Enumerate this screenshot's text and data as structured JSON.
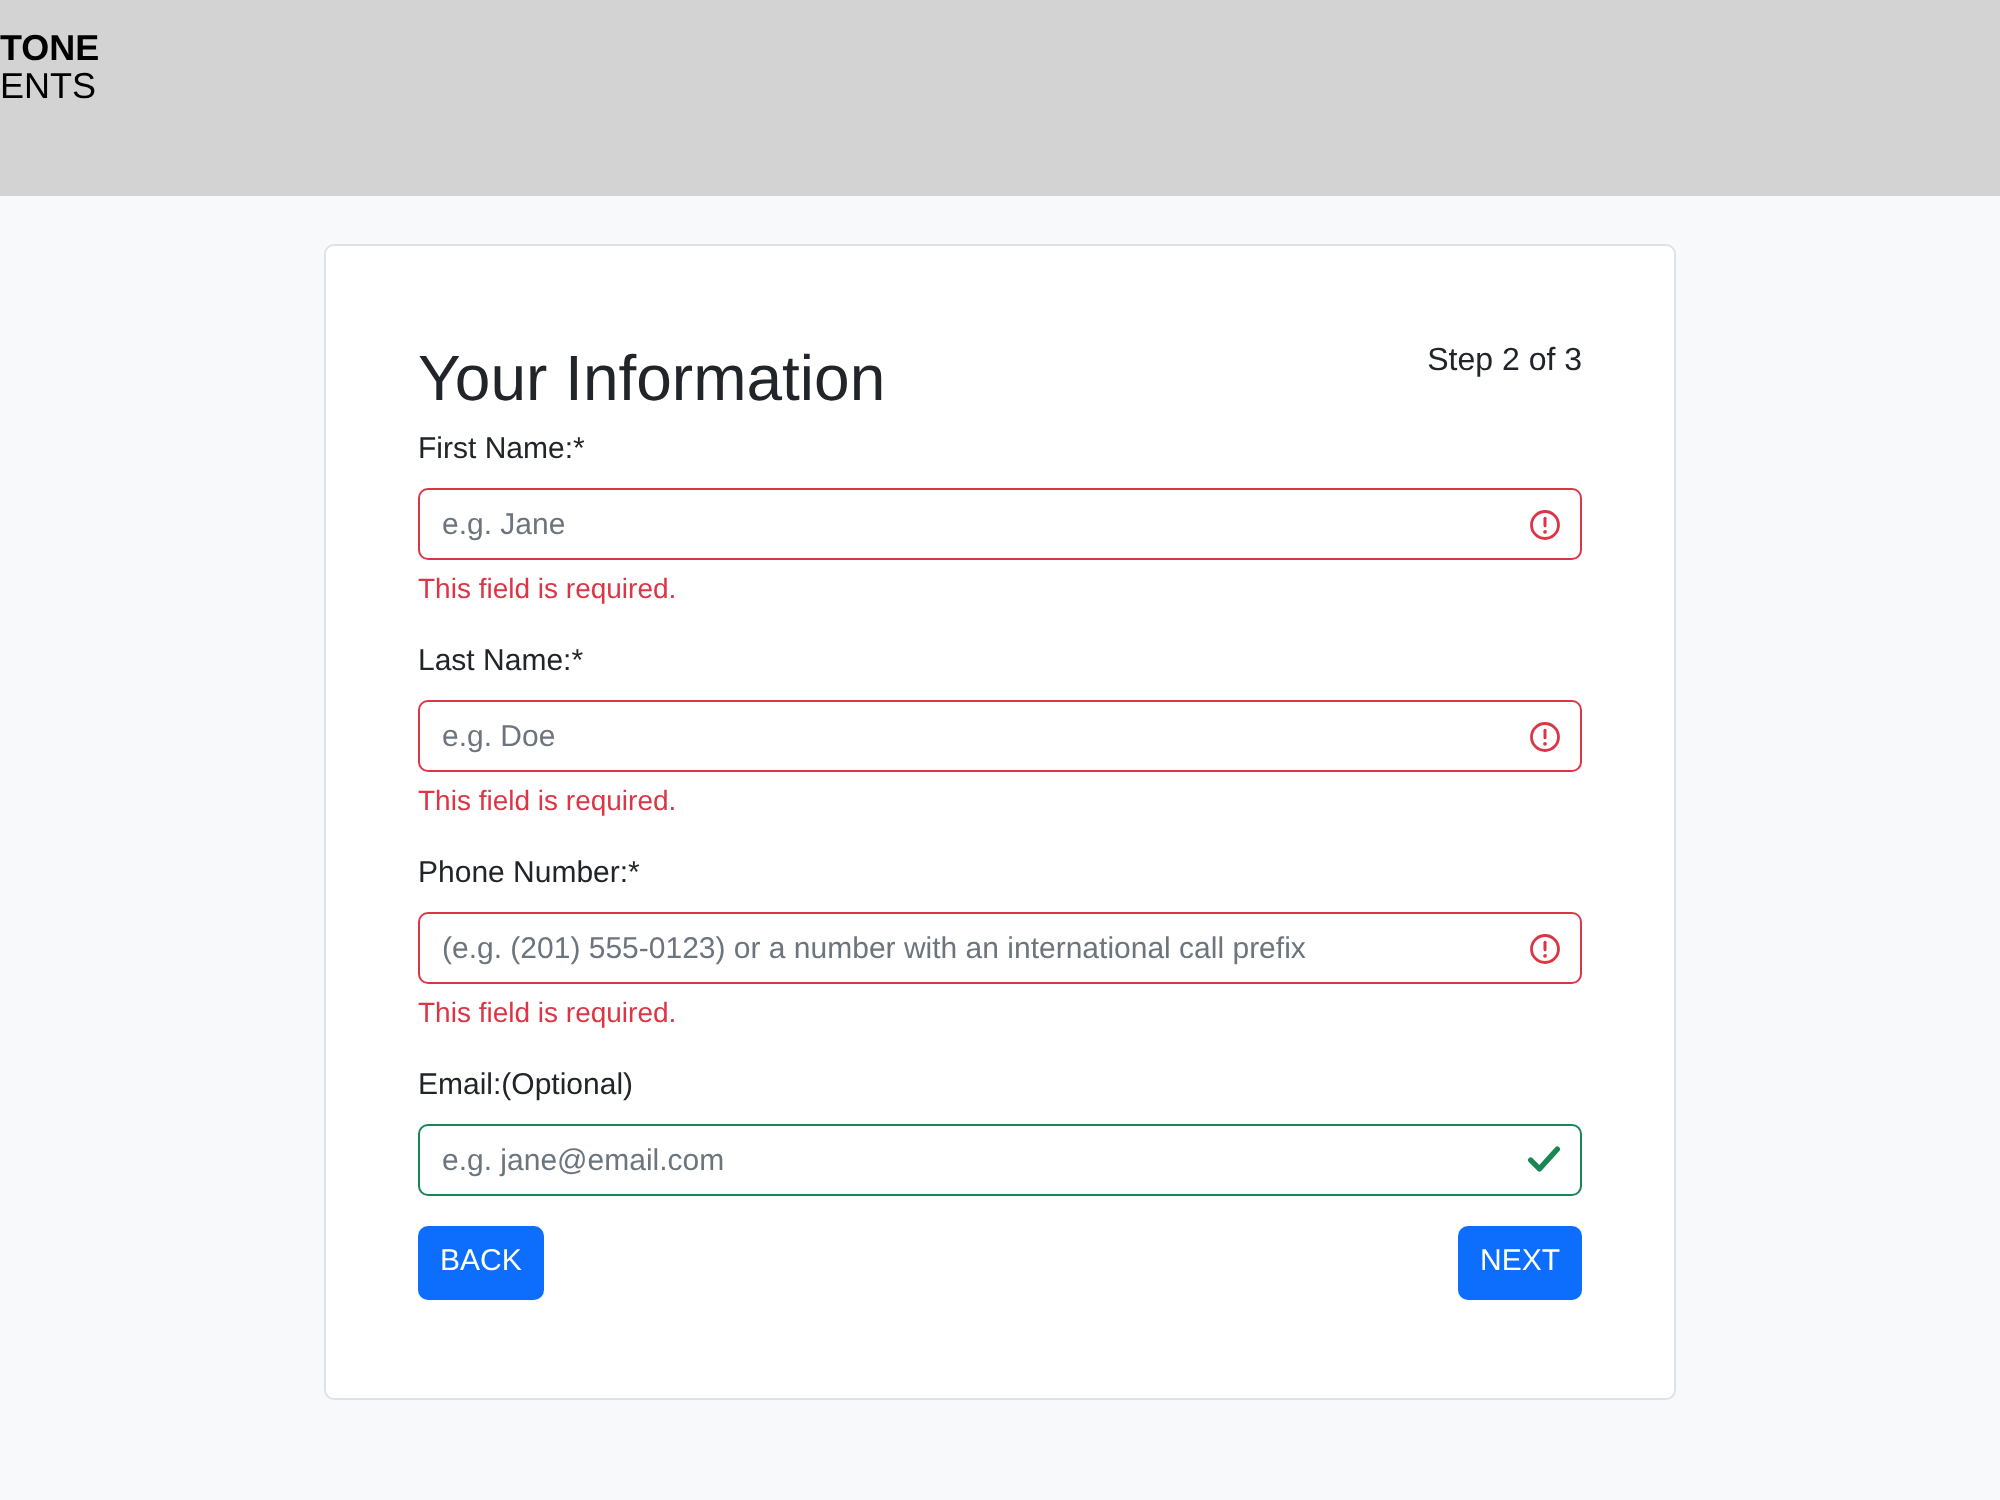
{
  "header": {
    "logo_lines": [
      "TONE",
      "ENTS"
    ]
  },
  "form": {
    "title": "Your Information",
    "step": "Step 2 of 3",
    "fields": [
      {
        "label": "First Name:*",
        "placeholder": "e.g. Jane",
        "invalid": true,
        "error": "This field is required."
      },
      {
        "label": "Last Name:*",
        "placeholder": "e.g. Doe",
        "invalid": true,
        "error": "This field is required."
      },
      {
        "label": "Phone Number:*",
        "placeholder": "(e.g. (201) 555-0123) or a number with an international call prefix",
        "invalid": true,
        "error": "This field is required."
      },
      {
        "label": "Email:(Optional)",
        "placeholder": "e.g. jane@email.com",
        "invalid": false
      }
    ],
    "buttons": [
      {
        "label": "BACK"
      },
      {
        "label": "NEXT"
      }
    ]
  }
}
